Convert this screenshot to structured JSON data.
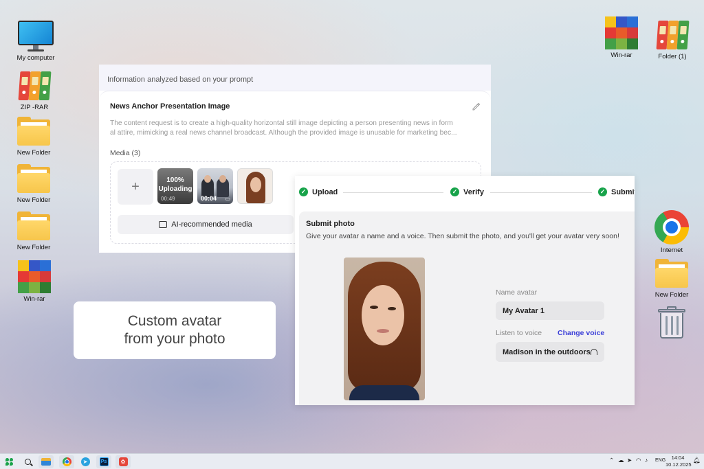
{
  "desktop": {
    "left_icons": [
      {
        "label": "My computer",
        "icon": "monitor-icon"
      },
      {
        "label": "ZIP -RAR",
        "icon": "binders-icon"
      },
      {
        "label": "New Folder",
        "icon": "folder-icon"
      },
      {
        "label": "New Folder",
        "icon": "folder-icon"
      },
      {
        "label": "New Folder",
        "icon": "folder-icon"
      },
      {
        "label": "Win-rar",
        "icon": "winrar-icon"
      }
    ],
    "right_icons": [
      {
        "label": "Win-rar",
        "icon": "winrar-icon"
      },
      {
        "label": "Folder (1)",
        "icon": "binders-icon"
      },
      {
        "label": "Internet",
        "icon": "chrome-icon"
      },
      {
        "label": "New Folder",
        "icon": "folder-icon"
      },
      {
        "label": "",
        "icon": "trash-icon"
      }
    ]
  },
  "info_panel": {
    "header": "Information analyzed based on your prompt",
    "title": "News Anchor Presentation Image",
    "description_line1": "The content request is to create a high-quality horizontal still image depicting a person presenting news in form",
    "description_line2": "al attire, mimicking a real news channel broadcast. Although the provided image is unusable for marketing bec...",
    "media_label": "Media (3)",
    "add_symbol": "+",
    "thumbnails": [
      {
        "percent": "100%",
        "status": "Uploading",
        "time": "00:49"
      },
      {
        "time": "00:04"
      },
      {}
    ],
    "ai_button": "AI-recommended media"
  },
  "upload_panel": {
    "steps": [
      {
        "label": "Upload",
        "done": true
      },
      {
        "label": "Verify",
        "done": true
      },
      {
        "label": "Submit",
        "done": true
      }
    ],
    "check_glyph": "✓",
    "submit_title": "Submit photo",
    "submit_desc": "Give your avatar a name and a voice. Then submit the photo, and you'll get your avatar very soon!",
    "name_label": "Name avatar",
    "name_value": "My Avatar 1",
    "voice_label": "Listen to voice",
    "change_voice": "Change voice",
    "voice_value": "Madison in the outdoors"
  },
  "callout": {
    "line1": "Custom avatar",
    "line2": "from your photo"
  },
  "taskbar": {
    "ps_label": "Ps",
    "language": "ENG",
    "time": "14:04",
    "date": "10.12.2025"
  },
  "colors": {
    "success": "#17a34a",
    "link": "#3b3fd8",
    "folder": "#f0b437"
  }
}
